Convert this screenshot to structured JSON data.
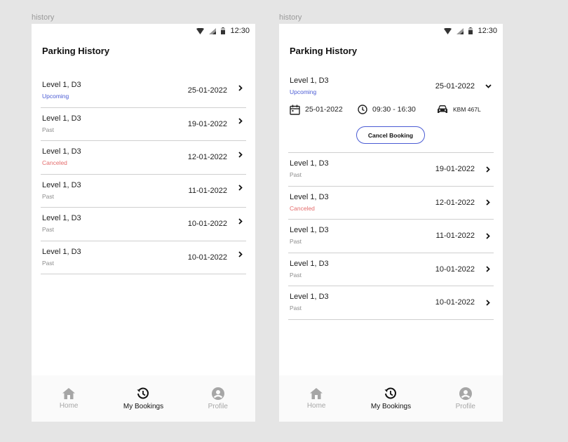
{
  "frames": [
    {
      "label": "history",
      "status": {
        "time": "12:30"
      },
      "title": "Parking History",
      "expanded": null,
      "rows": [
        {
          "location": "Level 1, D3",
          "status": "Upcoming",
          "kind": "upcoming",
          "date": "25-01-2022"
        },
        {
          "location": "Level 1, D3",
          "status": "Past",
          "kind": "past",
          "date": "19-01-2022"
        },
        {
          "location": "Level 1, D3",
          "status": "Canceled",
          "kind": "canceled",
          "date": "12-01-2022"
        },
        {
          "location": "Level 1, D3",
          "status": "Past",
          "kind": "past",
          "date": "11-01-2022"
        },
        {
          "location": "Level 1, D3",
          "status": "Past",
          "kind": "past",
          "date": "10-01-2022"
        },
        {
          "location": "Level 1, D3",
          "status": "Past",
          "kind": "past",
          "date": "10-01-2022"
        }
      ],
      "nav": [
        {
          "label": "Home",
          "icon": "home-icon",
          "active": false
        },
        {
          "label": "My Bookings",
          "icon": "history-icon",
          "active": true
        },
        {
          "label": "Profile",
          "icon": "profile-icon",
          "active": false
        }
      ]
    },
    {
      "label": "history",
      "status": {
        "time": "12:30"
      },
      "title": "Parking History",
      "expanded": {
        "location": "Level 1, D3",
        "status": "Upcoming",
        "date": "25-01-2022",
        "detail_date": "25-01-2022",
        "detail_time": "09:30 - 16:30",
        "detail_plate": "KBM 467L",
        "cancel_label": "Cancel Booking"
      },
      "rows": [
        {
          "location": "Level 1, D3",
          "status": "Past",
          "kind": "past",
          "date": "19-01-2022"
        },
        {
          "location": "Level 1, D3",
          "status": "Canceled",
          "kind": "canceled",
          "date": "12-01-2022"
        },
        {
          "location": "Level 1, D3",
          "status": "Past",
          "kind": "past",
          "date": "11-01-2022"
        },
        {
          "location": "Level 1, D3",
          "status": "Past",
          "kind": "past",
          "date": "10-01-2022"
        },
        {
          "location": "Level 1, D3",
          "status": "Past",
          "kind": "past",
          "date": "10-01-2022"
        }
      ],
      "nav": [
        {
          "label": "Home",
          "icon": "home-icon",
          "active": false
        },
        {
          "label": "My Bookings",
          "icon": "history-icon",
          "active": true
        },
        {
          "label": "Profile",
          "icon": "profile-icon",
          "active": false
        }
      ]
    }
  ],
  "colors": {
    "accent": "#4a5bd4",
    "canceled": "#e46c6c",
    "muted": "#8c8c8c"
  }
}
